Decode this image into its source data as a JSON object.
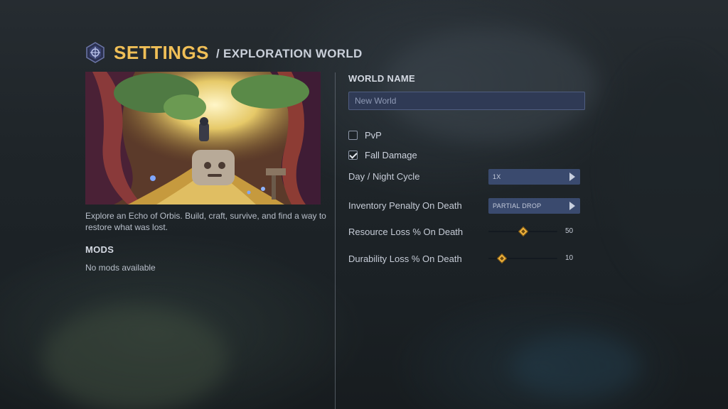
{
  "header": {
    "title": "SETTINGS",
    "subtitle": "/ EXPLORATION WORLD"
  },
  "world": {
    "description": "Explore an Echo of Orbis. Build, craft, survive, and find a way to restore what was lost.",
    "mods_label": "MODS",
    "mods_empty": "No mods available"
  },
  "world_name": {
    "label": "WORLD NAME",
    "placeholder": "New World"
  },
  "options": {
    "pvp": {
      "label": "PvP",
      "checked": false
    },
    "fall_damage": {
      "label": "Fall Damage",
      "checked": true
    },
    "day_night": {
      "label": "Day / Night Cycle",
      "value": "1X"
    },
    "inventory_penalty": {
      "label": "Inventory Penalty On Death",
      "value": "PARTIAL DROP"
    },
    "resource_loss": {
      "label": "Resource Loss % On Death",
      "value": 50,
      "display": "50",
      "fraction": 0.5
    },
    "durability_loss": {
      "label": "Durability Loss % On Death",
      "value": 10,
      "display": "10",
      "fraction": 0.1
    }
  },
  "colors": {
    "accent": "#f0bf57",
    "selector_bg": "#3a4a6e",
    "input_bg": "#2f3a55"
  },
  "icons": {
    "logo": "shield-emblem-icon",
    "arrow": "play-arrow-icon",
    "checkmark": "checkmark-icon"
  }
}
